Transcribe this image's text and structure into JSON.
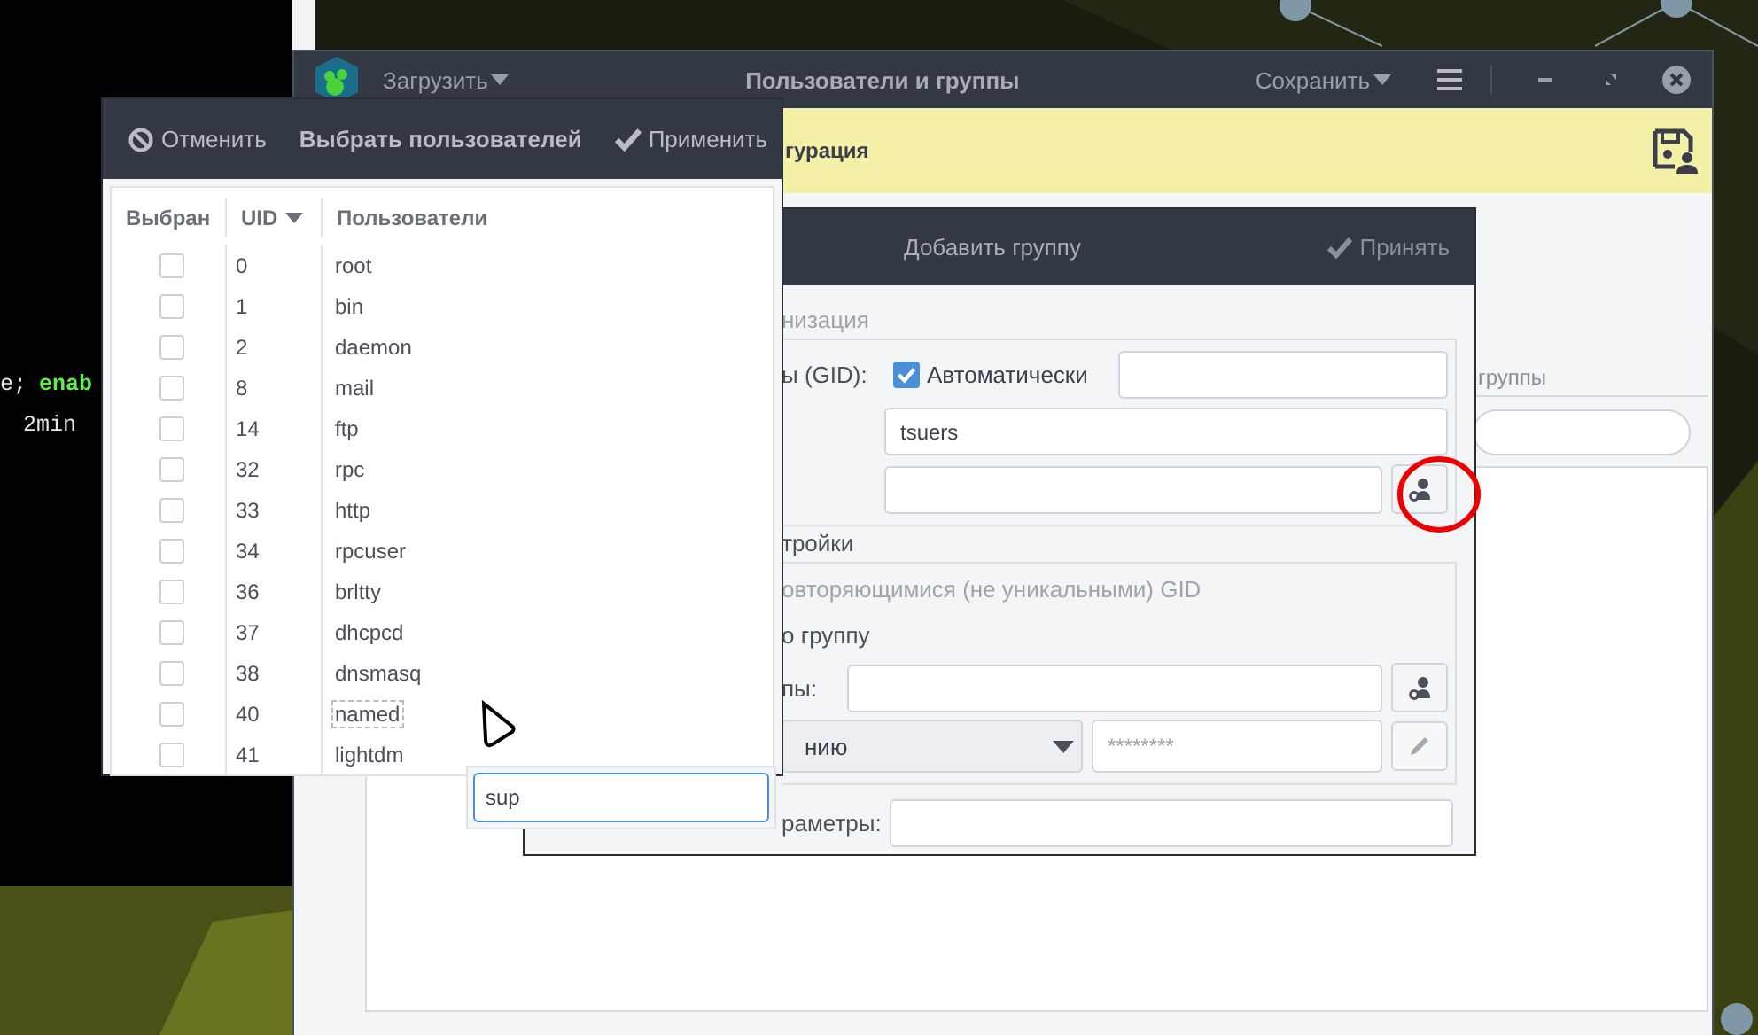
{
  "terminal": {
    "lines": [
      {
        "segments": [
          {
            "text": "e;",
            "kind": "plain"
          },
          {
            "text": "enab",
            "kind": "keyword"
          }
        ]
      },
      {
        "segments": [
          {
            "text": "2min",
            "kind": "plain"
          }
        ]
      }
    ]
  },
  "main_window": {
    "load_menu": "Загрузить",
    "title": "Пользователи и группы",
    "save_menu": "Сохранить",
    "banner": "гурация",
    "tab_label": "группы"
  },
  "group_dialog": {
    "title": "Добавить группу",
    "accept": "Принять",
    "section_1": "низация",
    "gid_label": "ы (GID):",
    "auto_gid": {
      "label": "Автоматически",
      "checked": true
    },
    "name_value": "tsuers",
    "section_2": "тройки",
    "non_unique": {
      "label": "овторяющимися (не уникальными) GID",
      "disabled": true
    },
    "join_label": "о группу",
    "members_label": "пы:",
    "password_mode": "нию",
    "password_value": "********",
    "edit_disabled": true,
    "extra_label": "раметры:"
  },
  "users_dialog": {
    "cancel": "Отменить",
    "title": "Выбрать пользователей",
    "apply": "Применить",
    "columns": [
      {
        "label": "Выбран",
        "sorted": false
      },
      {
        "label": "UID",
        "sorted": true
      },
      {
        "label": "Пользователи",
        "sorted": false
      }
    ],
    "rows": [
      {
        "uid": "0",
        "name": "root",
        "checked": false,
        "focused": false
      },
      {
        "uid": "1",
        "name": "bin",
        "checked": false,
        "focused": false
      },
      {
        "uid": "2",
        "name": "daemon",
        "checked": false,
        "focused": false
      },
      {
        "uid": "8",
        "name": "mail",
        "checked": false,
        "focused": false
      },
      {
        "uid": "14",
        "name": "ftp",
        "checked": false,
        "focused": false
      },
      {
        "uid": "32",
        "name": "rpc",
        "checked": false,
        "focused": false
      },
      {
        "uid": "33",
        "name": "http",
        "checked": false,
        "focused": false
      },
      {
        "uid": "34",
        "name": "rpcuser",
        "checked": false,
        "focused": false
      },
      {
        "uid": "36",
        "name": "brltty",
        "checked": false,
        "focused": false
      },
      {
        "uid": "37",
        "name": "dhcpcd",
        "checked": false,
        "focused": false
      },
      {
        "uid": "38",
        "name": "dnsmasq",
        "checked": false,
        "focused": false
      },
      {
        "uid": "40",
        "name": "named",
        "checked": false,
        "focused": true
      },
      {
        "uid": "41",
        "name": "lightdm",
        "checked": false,
        "focused": false
      }
    ]
  },
  "search_popup": {
    "value": "sup"
  }
}
